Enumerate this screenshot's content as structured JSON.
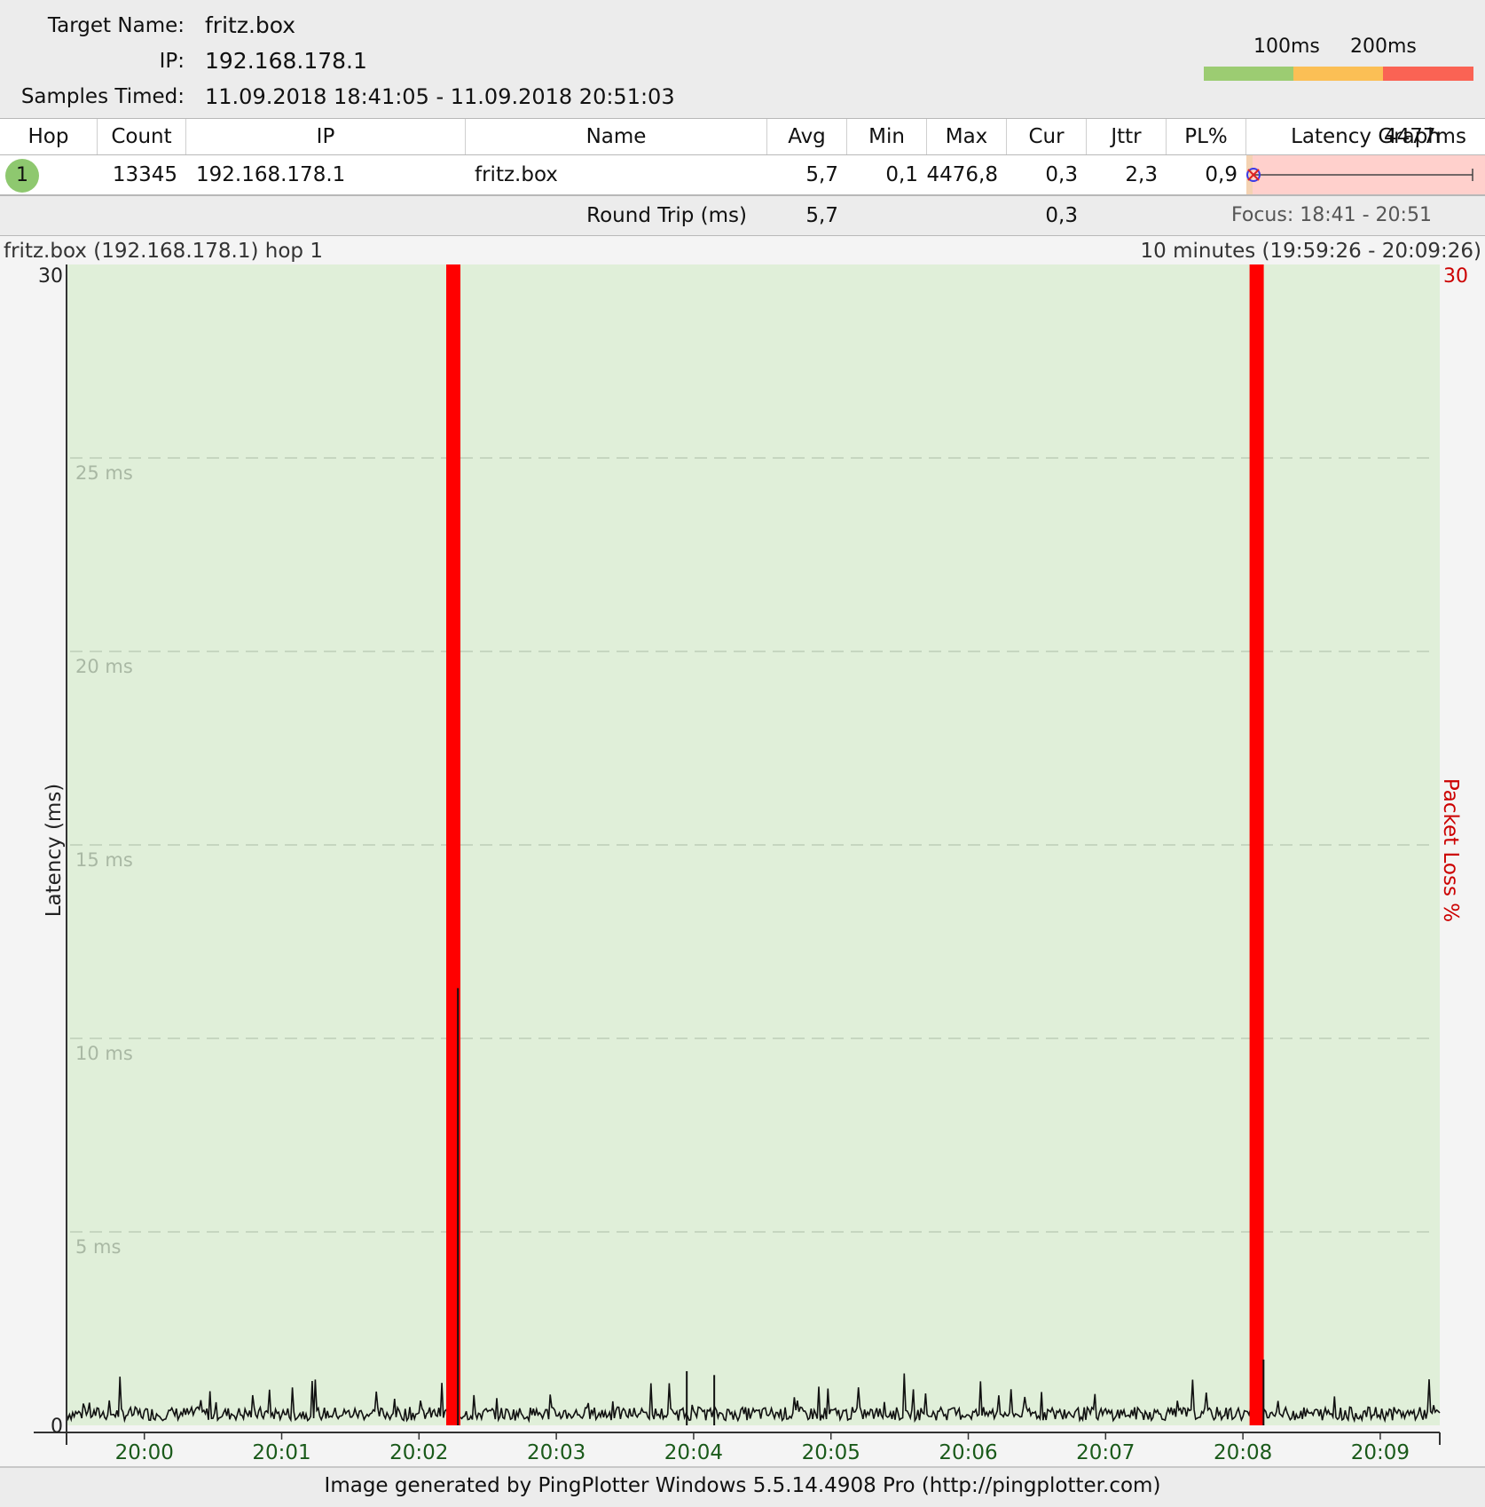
{
  "header": {
    "target_name_label": "Target Name:",
    "target_name_value": "fritz.box",
    "ip_label": "IP:",
    "ip_value": "192.168.178.1",
    "samples_label": "Samples Timed:",
    "samples_value": "11.09.2018 18:41:05 - 11.09.2018 20:51:03"
  },
  "threshold_legend": {
    "labels": [
      "100ms",
      "200ms"
    ],
    "colors": [
      "#9ccc72",
      "#fbbf55",
      "#fa6354"
    ]
  },
  "table": {
    "columns": [
      "Hop",
      "Count",
      "IP",
      "Name",
      "Avg",
      "Min",
      "Max",
      "Cur",
      "Jttr",
      "PL%",
      "Latency Graph"
    ],
    "graph_scale_label": "4477ms",
    "rows": [
      {
        "hop": "1",
        "count": "13345",
        "ip": "192.168.178.1",
        "name": "fritz.box",
        "avg": "5,7",
        "min": "0,1",
        "max": "4476,8",
        "cur": "0,3",
        "jttr": "2,3",
        "pl": "0,9"
      }
    ],
    "round_trip": {
      "label": "Round Trip (ms)",
      "avg": "5,7",
      "cur": "0,3"
    },
    "focus": "Focus: 18:41 - 20:51"
  },
  "graph": {
    "title_left": "fritz.box (192.168.178.1) hop 1",
    "title_right": "10 minutes (19:59:26 - 20:09:26)",
    "y_axis_label": "Latency (ms)",
    "y2_axis_label": "Packet Loss %",
    "y_top_label": "30",
    "y_bottom_label": "0",
    "y2_top_label": "30",
    "colors": {
      "background": "#e0efd9",
      "loss": "#ff0000",
      "line": "#111111",
      "time_labels": "#1a5a1a",
      "loss_axis": "#cc0000"
    }
  },
  "chart_data": {
    "type": "line",
    "title": "fritz.box (192.168.178.1) hop 1",
    "xlabel": "",
    "ylabel": "Latency (ms)",
    "y2label": "Packet Loss %",
    "ylim": [
      0,
      30
    ],
    "y2lim": [
      0,
      30
    ],
    "xlim": [
      "19:59:26",
      "20:09:26"
    ],
    "x_ticks": [
      "20:00",
      "20:01",
      "20:02",
      "20:03",
      "20:04",
      "20:05",
      "20:06",
      "20:07",
      "20:08",
      "20:09"
    ],
    "gridlines": [
      {
        "value": 25,
        "label": "25 ms"
      },
      {
        "value": 20,
        "label": "20 ms"
      },
      {
        "value": 15,
        "label": "15 ms"
      },
      {
        "value": 10,
        "label": "10 ms"
      },
      {
        "value": 5,
        "label": "5 ms"
      }
    ],
    "packet_loss_events": [
      {
        "time": "20:02:15",
        "loss_percent": 100
      },
      {
        "time": "20:08:06",
        "loss_percent": 100
      }
    ],
    "latency_spikes": [
      {
        "time": "20:02:17",
        "ms": 11.3
      },
      {
        "time": "20:03:57",
        "ms": 1.4
      },
      {
        "time": "20:04:09",
        "ms": 1.3
      },
      {
        "time": "20:08:09",
        "ms": 1.7
      }
    ],
    "baseline_ms": 0.3,
    "series": [
      {
        "name": "",
        "note": "",
        "values": []
      }
    ]
  },
  "footer": {
    "text": "Image generated by PingPlotter Windows 5.5.14.4908 Pro (http://pingplotter.com)"
  }
}
